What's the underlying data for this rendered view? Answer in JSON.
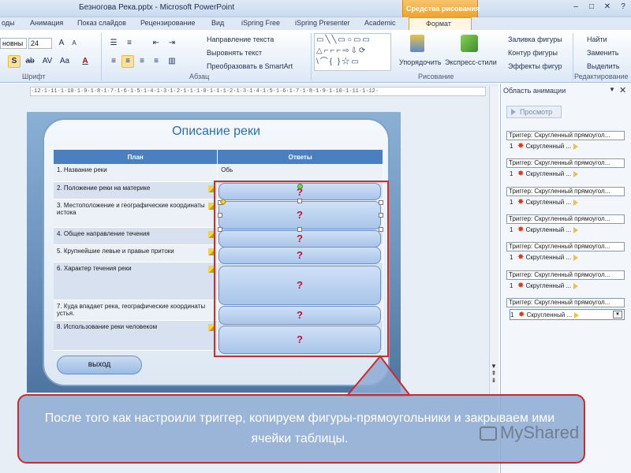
{
  "window": {
    "title": "Безногова Река.pptx - Microsoft PowerPoint",
    "context_group": "Средства рисования"
  },
  "tabs": [
    "оды",
    "Анимация",
    "Показ слайдов",
    "Рецензирование",
    "Вид",
    "iSpring Free",
    "iSpring Presenter",
    "Academic",
    "Формат"
  ],
  "ribbon": {
    "font_name": "новны",
    "font_size": "24",
    "groups": {
      "font": "Шрифт",
      "paragraph": "Абзац",
      "drawing": "Рисование",
      "editing": "Редактирование"
    },
    "paragraph_cmds": [
      "Направление текста",
      "Выровнять текст",
      "Преобразовать в SmartArt"
    ],
    "drawing_cmds": [
      "Упорядочить",
      "Экспресс-стили"
    ],
    "shape_cmds": [
      "Заливка фигуры",
      "Контур фигуры",
      "Эффекты фигур"
    ],
    "editing_cmds": [
      "Найти",
      "Заменить",
      "Выделить"
    ]
  },
  "ruler": "·12·1·11·1·10·1·9·1·8·1·7·1·6·1·5·1·4·1·3·1·2·1·1·1·0·1·1·1·2·1·3·1·4·1·5·1·6·1·7·1·8·1·9·1·10·1·11·1·12·",
  "slide": {
    "title": "Описание реки",
    "table": {
      "headers": [
        "План",
        "Ответы"
      ],
      "rows": [
        {
          "plan": "1. Название реки",
          "answer": "Обь"
        },
        {
          "plan": "2. Положение реки на материке",
          "answer": ""
        },
        {
          "plan": "3. Местоположение и географические координаты истока",
          "answer": ""
        },
        {
          "plan": "4. Общее направление течения",
          "answer": ""
        },
        {
          "plan": "5. Крупнейшие левые и правые притоки",
          "answer": ""
        },
        {
          "plan": "6. Характер течения реки",
          "answer": ""
        },
        {
          "plan": "7. Куда впадает река, географические координаты устья.",
          "answer": ""
        },
        {
          "plan": "8. Использование реки человеком",
          "answer": ""
        }
      ]
    },
    "question_mark": "?",
    "exit_button": "выход"
  },
  "animation_pane": {
    "title": "Область анимации",
    "preview": "Просмотр",
    "trigger_label": "Триггер: Скругленный прямоугол...",
    "item_number": "1",
    "item_label": "Скругленный ..."
  },
  "callout": {
    "text": "После того как настроили триггер, копируем фигуры-прямоугольники и закрываем ими ячейки таблицы."
  },
  "watermark": "MyShared",
  "colors": {
    "accent": "#4a7fc0",
    "callout_border": "#cc2a2a",
    "question": "#c0143c"
  }
}
